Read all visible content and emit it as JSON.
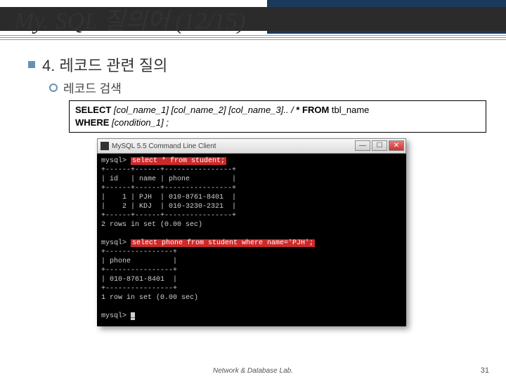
{
  "title": "My. SQL 질의어 (12/15)",
  "section": {
    "num_title": "4. 레코드 관련 질의",
    "sub": "레코드 검색"
  },
  "code": {
    "kw1": "SELECT ",
    "cols": "[col_name_1] [col_name_2] [col_name_3].. / ",
    "star": "* FROM ",
    "tbl": "tbl_name",
    "kw2": "WHERE ",
    "cond": "[condition_1] ;"
  },
  "term": {
    "winTitle": "MySQL 5.5 Command Line Client",
    "prompt1": "mysql> ",
    "q1": "select * from student;",
    "sep1": "+------+------+----------------+",
    "hdr": "| id   | name | phone          |",
    "row1": "|    1 | PJH  | 010-8761-8401  |",
    "row2": "|    2 | KDJ  | 010-3230-2321  |",
    "rows1": "2 rows in set (0.00 sec)",
    "q2": "select phone from student where name='PJH';",
    "sep2": "+----------------+",
    "hdr2": "| phone          |",
    "row3": "| 010-8761-8401  |",
    "rows2": "1 row in set (0.00 sec)",
    "cursor": "_"
  },
  "footer": "Network & Database Lab.",
  "page": "31"
}
